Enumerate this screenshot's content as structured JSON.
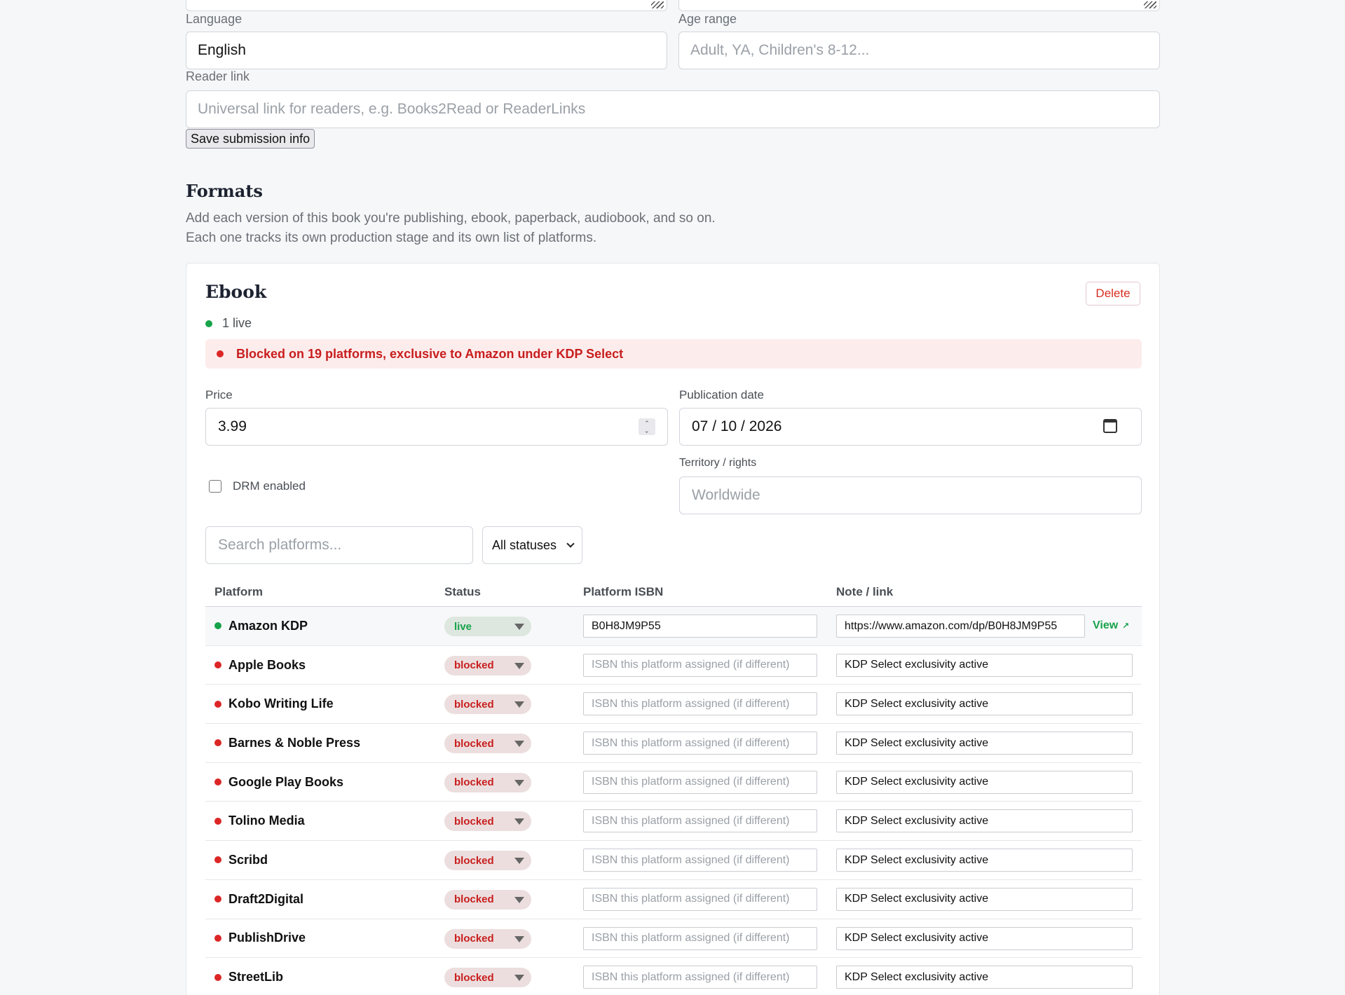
{
  "submission": {
    "language_label": "Language",
    "language_value": "English",
    "age_range_label": "Age range",
    "age_range_placeholder": "Adult, YA, Children's 8-12...",
    "reader_link_label": "Reader link",
    "reader_link_placeholder": "Universal link for readers, e.g. Books2Read or ReaderLinks",
    "save_label": "Save submission info"
  },
  "formats": {
    "heading": "Formats",
    "description": "Add each version of this book you're publishing, ebook, paperback, audiobook, and so on. Each one tracks its own production stage and its own list of platforms."
  },
  "card": {
    "title": "Ebook",
    "delete_label": "Delete",
    "live_summary": "1 live",
    "alert_text": "Blocked on 19 platforms, exclusive to Amazon under KDP Select",
    "price_label": "Price",
    "price_value": "3.99",
    "pubdate_label": "Publication date",
    "pubdate_value": "07 / 10 / 2026",
    "drm_label": "DRM enabled",
    "territory_label": "Territory / rights",
    "territory_placeholder": "Worldwide",
    "search_placeholder": "Search platforms...",
    "status_filter": "All statuses"
  },
  "table": {
    "headers": {
      "platform": "Platform",
      "status": "Status",
      "isbn": "Platform ISBN",
      "note": "Note / link"
    },
    "isbn_placeholder": "ISBN this platform assigned (if different)",
    "view_label": "View",
    "view_arrow": "↗",
    "rows": [
      {
        "platform": "Amazon KDP",
        "status": "live",
        "isbn": "B0H8JM9P55",
        "note": "https://www.amazon.com/dp/B0H8JM9P55"
      },
      {
        "platform": "Apple Books",
        "status": "blocked",
        "note": "KDP Select exclusivity active"
      },
      {
        "platform": "Kobo Writing Life",
        "status": "blocked",
        "note": "KDP Select exclusivity active"
      },
      {
        "platform": "Barnes & Noble Press",
        "status": "blocked",
        "note": "KDP Select exclusivity active"
      },
      {
        "platform": "Google Play Books",
        "status": "blocked",
        "note": "KDP Select exclusivity active"
      },
      {
        "platform": "Tolino Media",
        "status": "blocked",
        "note": "KDP Select exclusivity active"
      },
      {
        "platform": "Scribd",
        "status": "blocked",
        "note": "KDP Select exclusivity active"
      },
      {
        "platform": "Draft2Digital",
        "status": "blocked",
        "note": "KDP Select exclusivity active"
      },
      {
        "platform": "PublishDrive",
        "status": "blocked",
        "note": "KDP Select exclusivity active"
      },
      {
        "platform": "StreetLib",
        "status": "blocked",
        "note": "KDP Select exclusivity active"
      }
    ]
  },
  "colors": {
    "live": "#16a34a",
    "blocked": "#dc2626",
    "danger_text": "#c81e1e"
  }
}
